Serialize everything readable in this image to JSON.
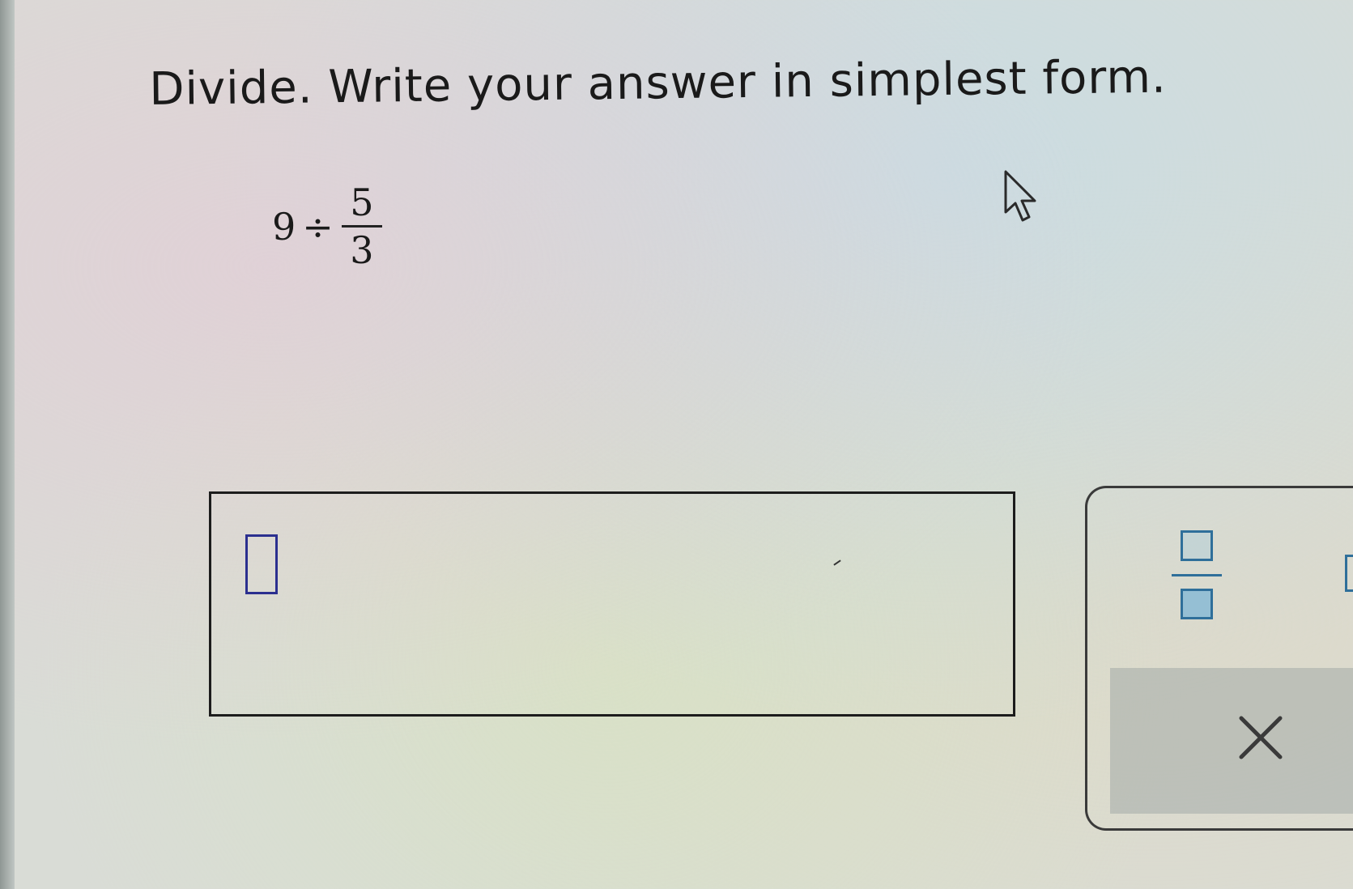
{
  "instruction": "Divide. Write your answer in simplest form.",
  "problem": {
    "whole": "9",
    "operator": "÷",
    "numerator": "5",
    "denominator": "3"
  },
  "answer": {
    "value": ""
  },
  "toolbar": {
    "fraction_tool_icon": "fraction-template-icon",
    "clear_icon": "x-icon"
  },
  "colors": {
    "answer_slot_border": "#2b2f8f",
    "tool_accent": "#2f6f9a"
  }
}
